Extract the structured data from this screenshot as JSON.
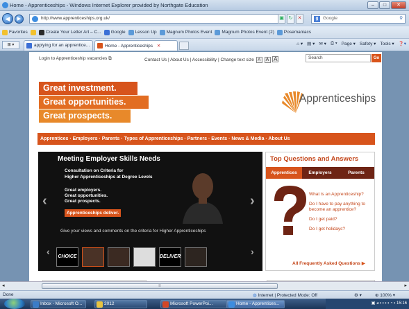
{
  "window": {
    "title": "Home - Apprenticeships - Windows Internet Explorer provided by Northgate Education"
  },
  "address": {
    "url": "http://www.apprenticeships.org.uk/",
    "search_placeholder": "Google"
  },
  "favorites": {
    "label": "Favorites",
    "items": [
      "Create Your Letter Art – C...",
      "Google",
      "Lesson Up",
      "Magnum Photos Event",
      "Magnum Photos Event (2)",
      "Posemaniacs"
    ]
  },
  "tabs": [
    {
      "label": "applying for an apprentice..."
    },
    {
      "label": "Home - Apprenticeships"
    }
  ],
  "toolbar": {
    "page": "Page ▾",
    "safety": "Safety ▾",
    "tools": "Tools ▾"
  },
  "site": {
    "login": "Login to Apprenticeship vacancies",
    "util_links": "Contact Us | About Us | Accessibility | Change text size",
    "text_sizes": [
      "A",
      "A",
      "A"
    ],
    "search_placeholder": "Search",
    "search_go": "Go",
    "hero": [
      "Great investment.",
      "Great opportunities.",
      "Great prospects."
    ],
    "logo_text": "Apprenticeships",
    "nav": "Apprentices · Employers · Parents · Types of Apprenticeships · Partners · Events · News & Media · About Us",
    "feature": {
      "heading": "Meeting Employer Skills Needs",
      "line1": "Consultation on Criteria for",
      "line2": "Higher Apprenticeships at Degree Levels",
      "bullets": [
        "Great employers.",
        "Great opportunities.",
        "Great prospects."
      ],
      "badge": "Apprenticeships deliver.",
      "caption": "Give your views and comments on the criteria for Higher Apprenticeships",
      "thumbs": [
        "CHOICE",
        "",
        "",
        "",
        "DELIVER",
        ""
      ]
    },
    "qa": {
      "heading": "Top Questions and Answers",
      "tabs": [
        "Apprentices",
        "Employers",
        "Parents"
      ],
      "links": [
        "What is an Apprenticeship?",
        "Do I have to pay anything to become an apprentice?",
        "Do I get paid?",
        "Do I get holidays?"
      ],
      "all": "All Frequently Asked Questions"
    }
  },
  "status": {
    "left": "Done",
    "zone": "Internet | Protected Mode: Off",
    "zoom": "100%"
  },
  "taskbar": {
    "items": [
      "Inbox - Microsoft O...",
      "2012",
      "Microsoft PowerPoi...",
      "Home - Apprentices..."
    ],
    "clock": "15:16"
  },
  "colors": {
    "brand_orange": "#d7541c",
    "brand_dark": "#6e2414"
  }
}
